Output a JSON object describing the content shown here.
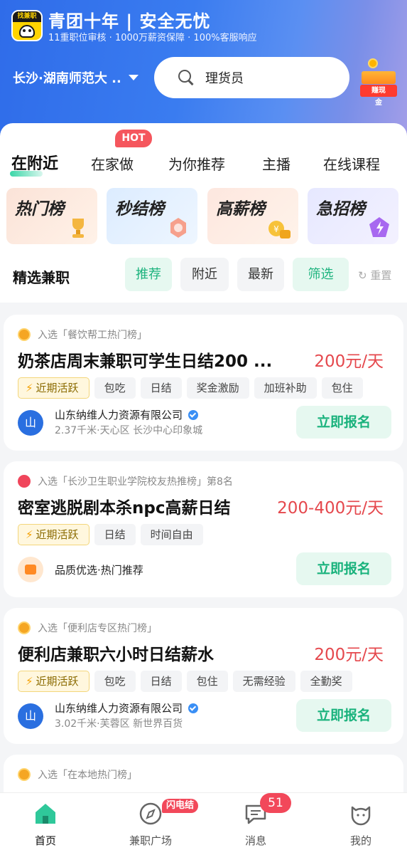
{
  "header": {
    "logo_text": "找兼职",
    "slogan": "青团十年 | 安全无忧",
    "sub_slogan": "11重职位审核 · 1000万薪资保障 · 100%客服响应",
    "location": "长沙·湖南师范大 ..",
    "search_placeholder": "理货员",
    "earn_label": "赚现金"
  },
  "tabs": {
    "hot_badge": "HOT",
    "items": [
      "在附近",
      "在家做",
      "为你推荐",
      "主播",
      "在线课程"
    ]
  },
  "ranks": [
    "热门榜",
    "秒结榜",
    "高薪榜",
    "急招榜"
  ],
  "filters": {
    "title": "精选兼职",
    "chips": [
      "推荐",
      "附近",
      "最新",
      "筛选"
    ],
    "reset": "重置"
  },
  "jobs": [
    {
      "selection": "入选「餐饮帮工热门榜」",
      "title": "奶茶店周末兼职可学生日结200 ...",
      "salary": "200元/天",
      "tags": [
        "近期活跃",
        "包吃",
        "日结",
        "奖金激励",
        "加班补助",
        "包住"
      ],
      "company": "山东纳维人力资源有限公司",
      "company_logo": "山",
      "address": "2.37千米·天心区 长沙中心印象城",
      "apply": "立即报名"
    },
    {
      "selection": "入选「长沙卫生职业学院校友热推榜」第8名",
      "title": "密室逃脱剧本杀npc高薪日结",
      "salary": "200-400元/天",
      "tags": [
        "近期活跃",
        "日结",
        "时间自由"
      ],
      "quality": "品质优选·热门推荐",
      "apply": "立即报名"
    },
    {
      "selection": "入选「便利店专区热门榜」",
      "title": "便利店兼职六小时日结薪水",
      "salary": "200元/天",
      "tags": [
        "近期活跃",
        "包吃",
        "日结",
        "包住",
        "无需经验",
        "全勤奖"
      ],
      "company": "山东纳维人力资源有限公司",
      "company_logo": "山",
      "address": "3.02千米·芙蓉区 新世界百货",
      "apply": "立即报名"
    },
    {
      "selection": "入选「在本地热门榜」"
    }
  ],
  "bottom_nav": {
    "items": [
      "首页",
      "兼职广场",
      "消息",
      "我的"
    ],
    "flash_badge": "闪电结",
    "message_count": "51"
  },
  "colors": {
    "header_blue": "#2f6ce9",
    "accent_green": "#19b27c",
    "salary_red": "#e5484d",
    "badge_red": "#f2485a"
  }
}
